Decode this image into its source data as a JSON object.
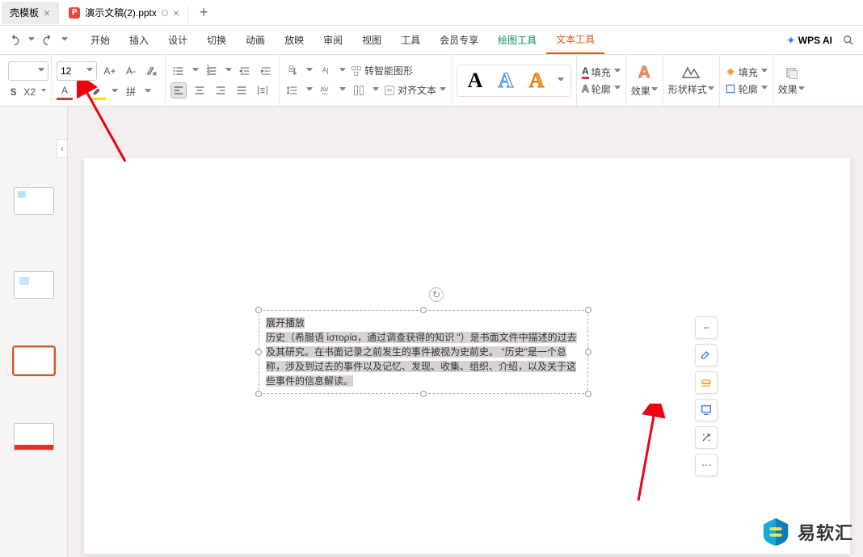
{
  "tabs": {
    "items": [
      {
        "title": "壳模板",
        "modified": false
      },
      {
        "title": "演示文稿(2).pptx",
        "modified": true
      }
    ]
  },
  "menubar": {
    "items": [
      "开始",
      "插入",
      "设计",
      "切换",
      "动画",
      "放映",
      "审阅",
      "视图",
      "工具",
      "会员专享",
      "绘图工具",
      "文本工具"
    ],
    "wps_ai": "WPS AI"
  },
  "ribbon": {
    "font_size": "12",
    "convert_smart": "转智能图形",
    "align_text": "对齐文本",
    "fill": "填充",
    "outline": "轮廓",
    "effect": "效果",
    "shape_style": "形状样式",
    "fill2": "填充",
    "outline2": "轮廓",
    "effect2": "效果"
  },
  "textbox": {
    "title": "展开播放",
    "body": "历史（希腊语 ἱστορία，通过调查获得的知识 \"）是书面文件中描述的过去及其研究。在书面记录之前发生的事件被视为史前史。 \"历史\"是一个总称，涉及到过去的事件以及记忆、发现、收集、组织、介绍，以及关于这些事件的信息解读。"
  },
  "watermark": {
    "text": "易软汇"
  }
}
